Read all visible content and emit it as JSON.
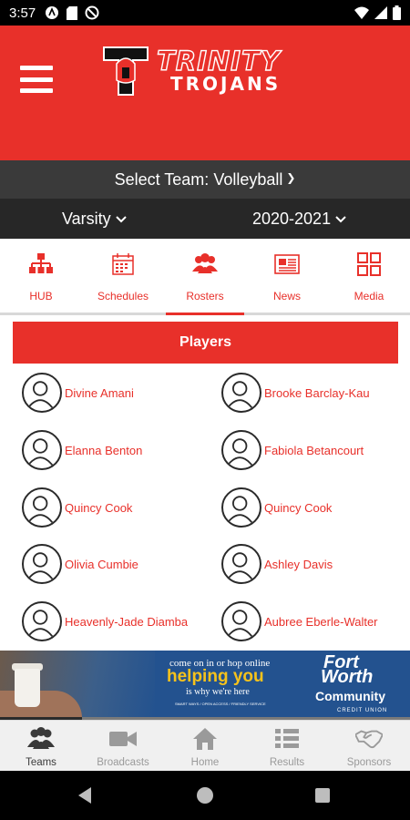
{
  "status_bar": {
    "time": "3:57"
  },
  "header": {
    "logo_line1": "TRINITY",
    "logo_line2": "TROJANS"
  },
  "selectors": {
    "team_label": "Select Team:",
    "team_value": "Volleyball",
    "level": "Varsity",
    "season": "2020-2021"
  },
  "tabs": [
    {
      "label": "HUB",
      "icon": "hierarchy-icon"
    },
    {
      "label": "Schedules",
      "icon": "calendar-icon"
    },
    {
      "label": "Rosters",
      "icon": "people-icon",
      "active": true
    },
    {
      "label": "News",
      "icon": "newspaper-icon"
    },
    {
      "label": "Media",
      "icon": "grid-icon"
    }
  ],
  "roster": {
    "heading": "Players",
    "players": [
      "Divine Amani",
      "Brooke Barclay-Kau",
      "Elanna Benton",
      "Fabiola Betancourt",
      "Quincy Cook",
      "Quincy Cook",
      "Olivia Cumbie",
      "Ashley Davis",
      "Heavenly-Jade Diamba",
      "Aubree Eberle-Walter"
    ]
  },
  "ad": {
    "line1": "come on in or hop online",
    "line2": "helping you",
    "line3": "is why we're here",
    "fine_print": "SMART WAYS / OPEN ACCESS / FRIENDLY SERVICE",
    "brand1": "Fort",
    "brand2": "Worth",
    "brand3": "Community",
    "brand4": "CREDIT UNION"
  },
  "bottom_nav": [
    {
      "label": "Teams",
      "icon": "teams-icon",
      "active": true
    },
    {
      "label": "Broadcasts",
      "icon": "video-camera-icon"
    },
    {
      "label": "Home",
      "icon": "home-icon"
    },
    {
      "label": "Results",
      "icon": "list-icon"
    },
    {
      "label": "Sponsors",
      "icon": "handshake-icon"
    }
  ],
  "colors": {
    "brand_red": "#e8302a",
    "dark_bar": "#3a3a3a",
    "darker_bar": "#272727",
    "ad_blue": "#23528f"
  }
}
